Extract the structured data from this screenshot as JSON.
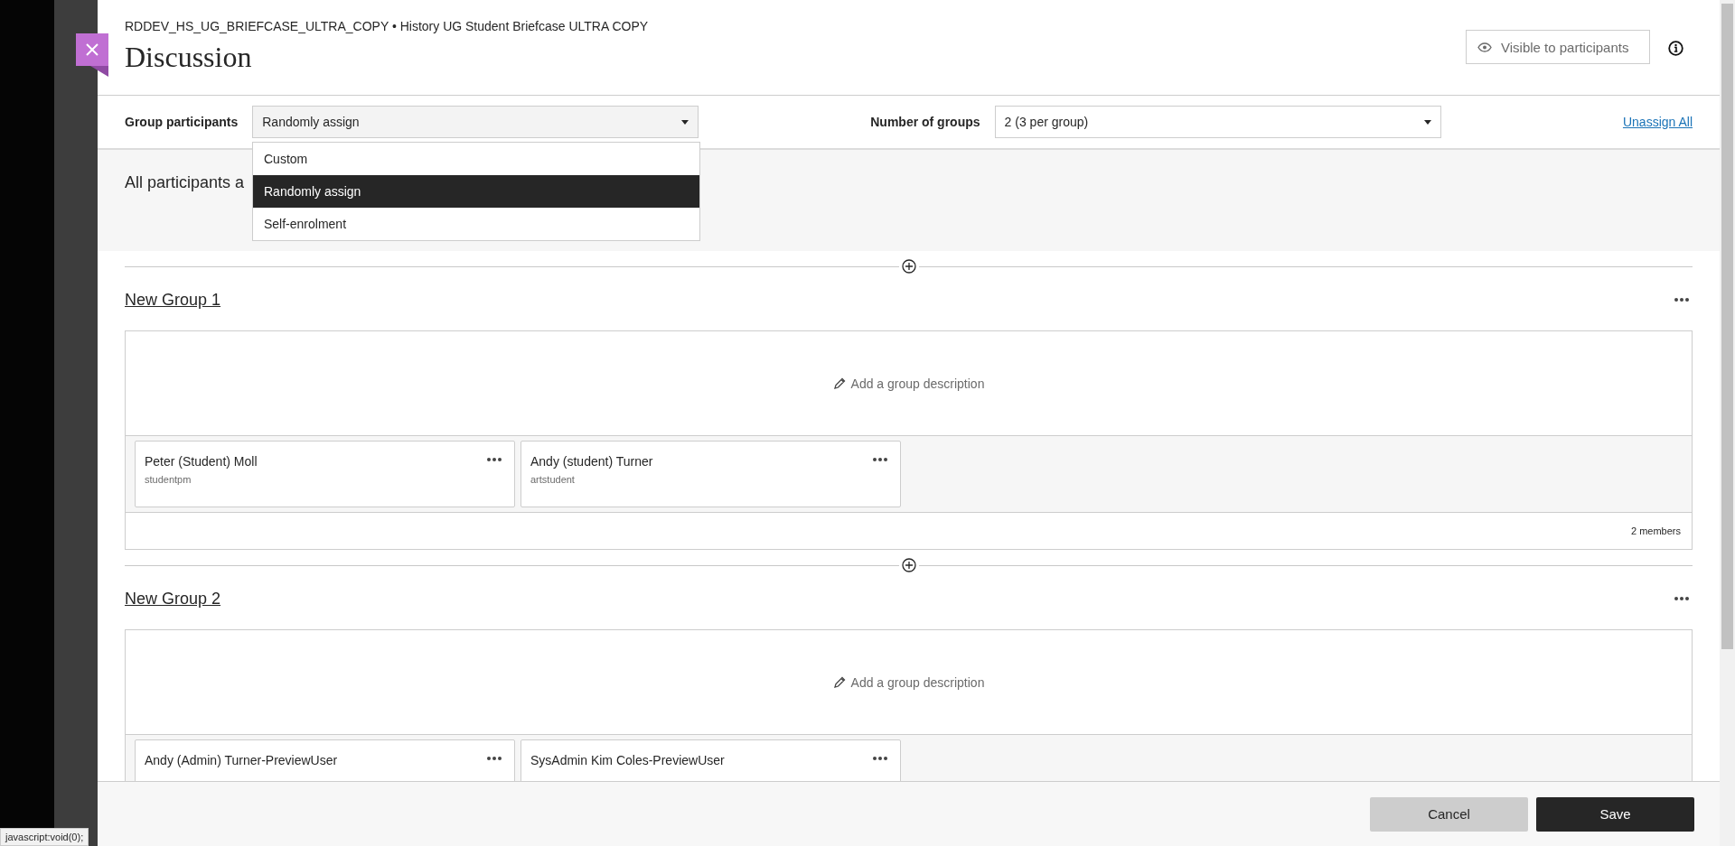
{
  "breadcrumb": "RDDEV_HS_UG_BRIEFCASE_ULTRA_COPY • History UG Student Briefcase ULTRA COPY",
  "title": "Discussion",
  "visibility_button": "Visible to participants",
  "group_participants": {
    "label": "Group participants",
    "value": "Randomly assign",
    "expanded": true,
    "options": [
      {
        "label": "Custom",
        "selected": false
      },
      {
        "label": "Randomly assign",
        "selected": true
      },
      {
        "label": "Self-enrolment",
        "selected": false
      }
    ]
  },
  "number_of_groups": {
    "label": "Number of groups",
    "value": "2 (3 per group)"
  },
  "unassign_link": "Unassign All",
  "section_heading": "All participants a",
  "groups": [
    {
      "title": "New Group 1",
      "description_prompt": "Add a group description",
      "member_count": "2 members",
      "members": [
        {
          "name": "Peter (Student) Moll",
          "username": "studentpm"
        },
        {
          "name": "Andy (student) Turner",
          "username": "artstudent"
        }
      ]
    },
    {
      "title": "New Group 2",
      "description_prompt": "Add a group description",
      "members": [
        {
          "name": "Andy (Admin) Turner-PreviewUser"
        },
        {
          "name": "SysAdmin Kim Coles-PreviewUser"
        }
      ]
    }
  ],
  "buttons": {
    "cancel": "Cancel",
    "save": "Save"
  },
  "status_text": "javascript:void(0);"
}
